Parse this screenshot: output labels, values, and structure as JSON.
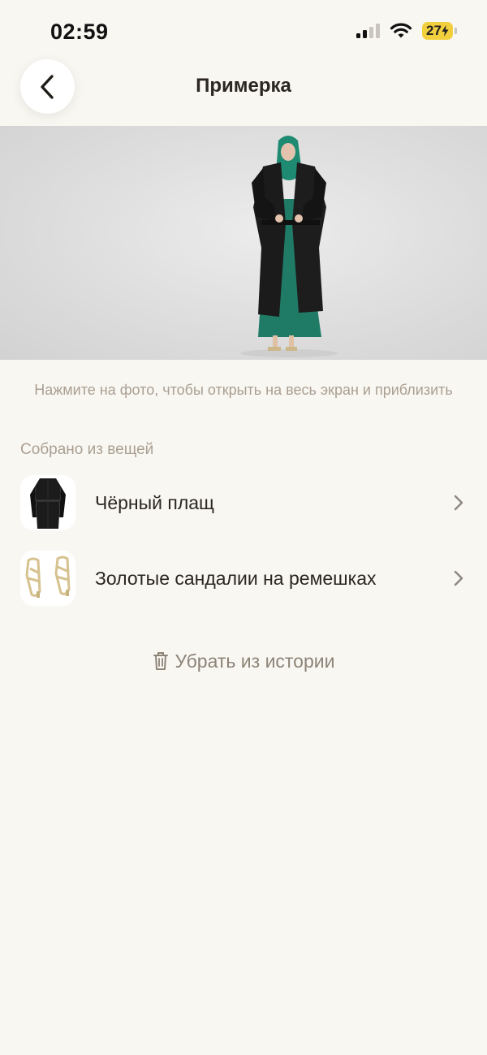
{
  "status_bar": {
    "time": "02:59",
    "battery": "27",
    "icons": [
      "signal-icon",
      "wifi-icon",
      "battery-charging-icon"
    ]
  },
  "header": {
    "title": "Примерка",
    "back_icon": "chevron-left-icon"
  },
  "photo": {
    "hint": "Нажмите на фото, чтобы открыть на весь экран и приблизить"
  },
  "items_section": {
    "title": "Собрано из вещей",
    "items": [
      {
        "name": "Чёрный плащ",
        "thumb": "black-coat-thumbnail"
      },
      {
        "name": "Золотые сандалии на ремешках",
        "thumb": "gold-sandals-thumbnail"
      }
    ]
  },
  "remove_button": {
    "label": "Убрать из истории",
    "icon": "trash-icon"
  },
  "colors": {
    "background": "#f9f7f2",
    "muted_text": "#aa9f92",
    "battery": "#f2cf3c"
  }
}
